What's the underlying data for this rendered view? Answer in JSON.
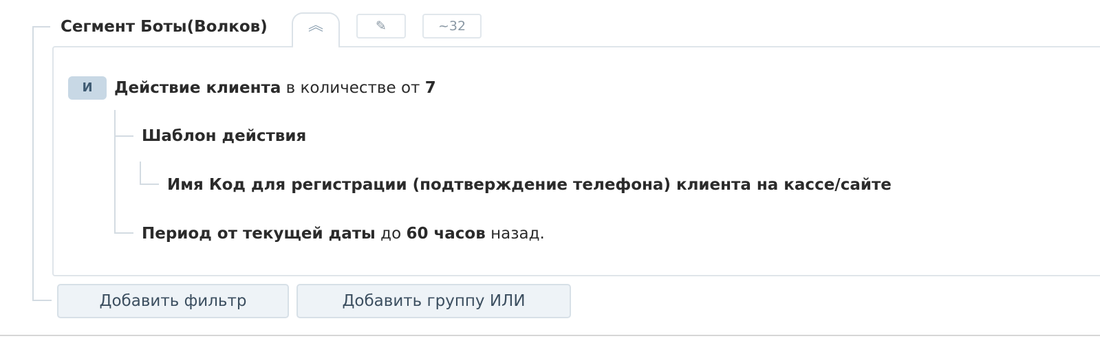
{
  "segment": {
    "title": "Сегмент Боты(Волков)",
    "toggle_icon": "chevron-double-up-icon",
    "toggle_glyph": "︽",
    "edit_icon": "pencil-icon",
    "edit_glyph": "✎",
    "count_label": "~32"
  },
  "condition": {
    "operator": "И",
    "action": {
      "label": "Действие клиента",
      "quantity_prefix": "в количестве от",
      "quantity_value": "7"
    },
    "template": {
      "label": "Шаблон действия",
      "name_text": "Имя Код для регистрации (подтверждение телефона) клиента на кассе/сайте"
    },
    "period": {
      "label": "Период от текущей даты",
      "to_word": "до",
      "value": "60 часов",
      "suffix": "назад."
    }
  },
  "buttons": {
    "add_filter": "Добавить фильтр",
    "add_or_group": "Добавить группу ИЛИ"
  },
  "colors": {
    "badge_bg": "#c8d8e5",
    "tree_line": "#d3dbe2",
    "button_bg": "#eef3f7"
  }
}
